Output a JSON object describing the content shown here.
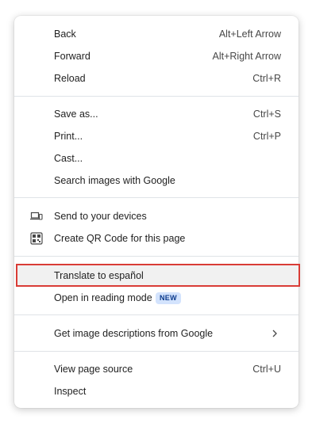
{
  "menu": {
    "back": {
      "label": "Back",
      "shortcut": "Alt+Left Arrow"
    },
    "forward": {
      "label": "Forward",
      "shortcut": "Alt+Right Arrow"
    },
    "reload": {
      "label": "Reload",
      "shortcut": "Ctrl+R"
    },
    "save_as": {
      "label": "Save as...",
      "shortcut": "Ctrl+S"
    },
    "print": {
      "label": "Print...",
      "shortcut": "Ctrl+P"
    },
    "cast": {
      "label": "Cast..."
    },
    "search_images": {
      "label": "Search images with Google"
    },
    "send_to_devices": {
      "label": "Send to your devices",
      "icon": "laptop-phone-icon"
    },
    "create_qr": {
      "label": "Create QR Code for this page",
      "icon": "qr-code-icon"
    },
    "translate": {
      "label": "Translate to español"
    },
    "reading_mode": {
      "label": "Open in reading mode",
      "badge": "NEW"
    },
    "image_descriptions": {
      "label": "Get image descriptions from Google",
      "icon": "chevron-right-icon"
    },
    "view_source": {
      "label": "View page source",
      "shortcut": "Ctrl+U"
    },
    "inspect": {
      "label": "Inspect"
    }
  },
  "colors": {
    "highlight_border": "#d93c36",
    "badge_bg": "#d3e3fd",
    "separator": "#dfe3e7"
  }
}
